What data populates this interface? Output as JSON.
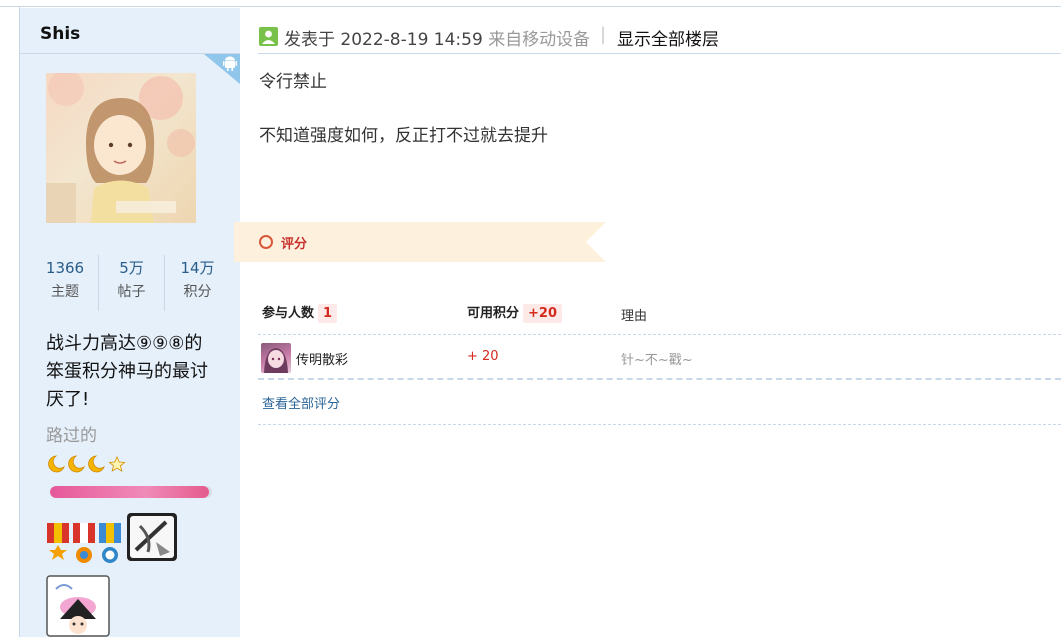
{
  "author": {
    "name": "Shis",
    "stats": [
      {
        "value": "1366",
        "label": "主题"
      },
      {
        "value": "5万",
        "label": "帖子"
      },
      {
        "value": "14万",
        "label": "积分"
      }
    ],
    "signature": "战斗力高达⑨⑨⑧的笨蛋积分神马的最讨厌了!",
    "rank_title": "路过的",
    "credit_progress": 0.98
  },
  "post": {
    "posted_prefix": "发表于",
    "posted_time": "2022-8-19 14:59",
    "posted_from": "来自移动设备",
    "separator": "|",
    "show_all_floors": "显示全部楼层",
    "body": [
      "令行禁止",
      "不知道强度如何，反正打不过就去提升"
    ]
  },
  "rating": {
    "section_label": "评分",
    "header": {
      "participants_label": "参与人数",
      "participants_count": "1",
      "points_label": "可用积分",
      "points_total": "+20",
      "reason_label": "理由"
    },
    "rows": [
      {
        "name": "传明散彩",
        "score": "+ 20",
        "reason": "针~不~戳~"
      }
    ],
    "view_all": "查看全部评分"
  }
}
